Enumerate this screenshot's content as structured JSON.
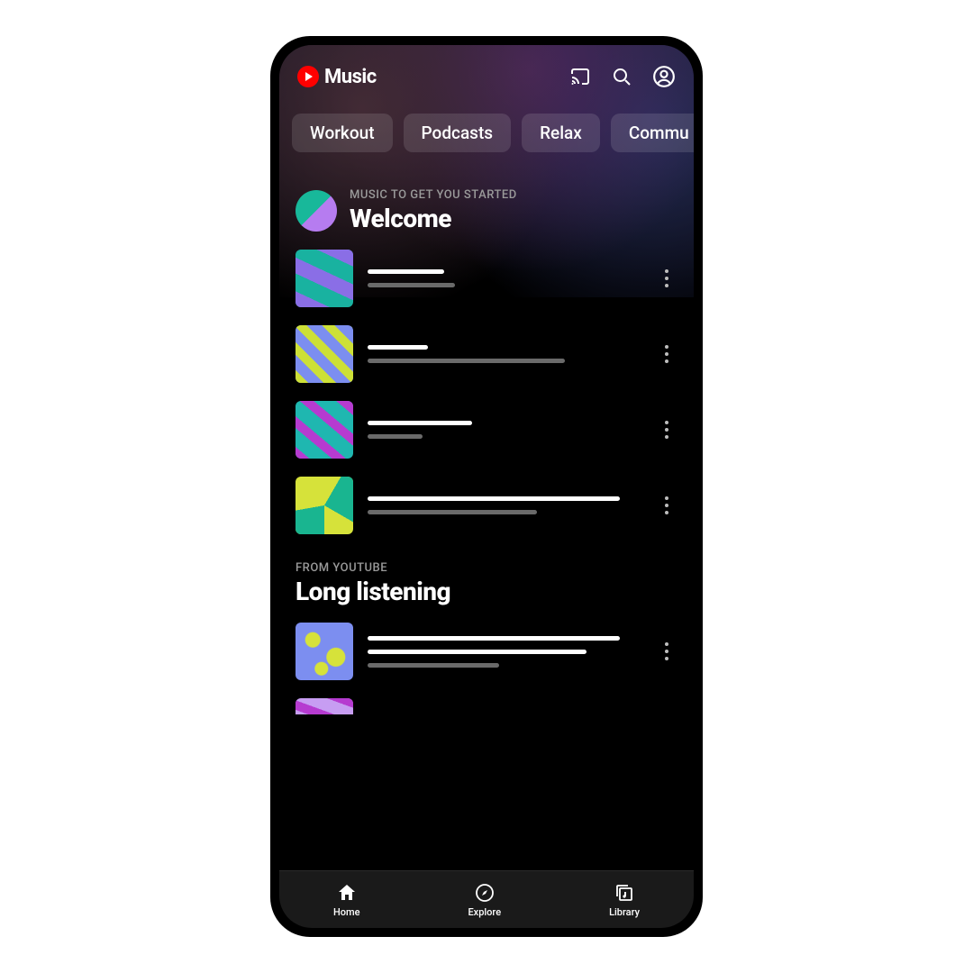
{
  "header": {
    "app_name": "Music"
  },
  "chips": [
    "Workout",
    "Podcasts",
    "Relax",
    "Commu"
  ],
  "sections": [
    {
      "kicker": "MUSIC TO GET YOU STARTED",
      "title": "Welcome",
      "has_avatar": true
    },
    {
      "kicker": "FROM YOUTUBE",
      "title": "Long listening",
      "has_avatar": false
    }
  ],
  "nav": {
    "home": "Home",
    "explore": "Explore",
    "library": "Library"
  }
}
